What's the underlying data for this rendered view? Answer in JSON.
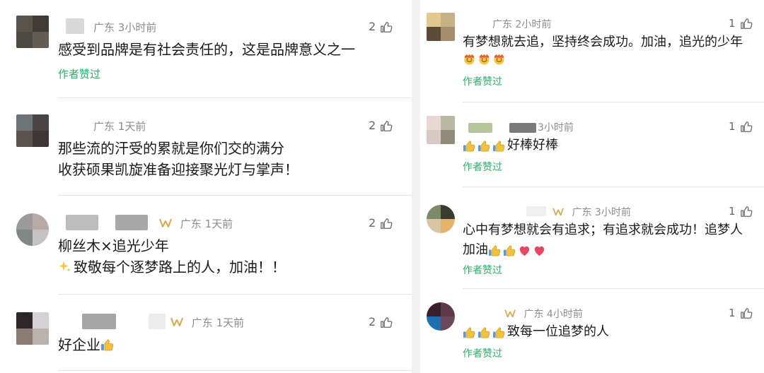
{
  "left": {
    "comments": [
      {
        "location": "广东",
        "time": "3小时前",
        "likes": "2",
        "lines": [
          "感受到品牌是有社会责任的，这是品牌意义之一"
        ],
        "liked_label": "作者赞过"
      },
      {
        "location": "广东",
        "time": "1天前",
        "likes": "2",
        "lines": [
          "那些流的汗受的累就是你们交的满分",
          "收获硕果凯旋准备迎接聚光灯与掌声！"
        ]
      },
      {
        "location": "广东",
        "time": "1天前",
        "likes": "2",
        "lines": [
          "柳丝木×追光少年",
          "致敬每个逐梦路上的人，加油！！"
        ]
      },
      {
        "location": "广东",
        "time": "1天前",
        "likes": "2",
        "lines": [
          "好企业"
        ]
      }
    ]
  },
  "right": {
    "comments": [
      {
        "location": "广东",
        "time": "2小时前",
        "likes": "1",
        "lines": [
          "有梦想就去追，坚持终会成功。加油，追光的少年"
        ],
        "liked_label": "作者赞过"
      },
      {
        "time": "3小时前",
        "likes": "1",
        "lines": [
          "好棒好棒"
        ],
        "liked_label": "作者赞过"
      },
      {
        "location": "广东",
        "time": "3小时前",
        "likes": "1",
        "lines": [
          "心中有梦想就会有追求；有追求就会成功！追梦人",
          "加油"
        ],
        "liked_label": "作者赞过"
      },
      {
        "location": "广东",
        "time": "4小时前",
        "likes": "1",
        "lines": [
          "致每一位追梦的人"
        ],
        "liked_label": "作者赞过"
      }
    ]
  },
  "icons": {
    "thumb": "thumbs-up-outline-icon",
    "medal": "fan-medal-icon",
    "sparkle": "sparkles-emoji-icon",
    "thumbs_emoji": "thumbs-up-emoji-icon",
    "heart_emoji": "red-heart-emoji-icon",
    "cheer_emoji": "cheering-face-emoji-icon"
  },
  "colors": {
    "liked_green": "#2aae67",
    "meta_gray": "#8c8c8c",
    "medal_gold": "#d7a94c",
    "heart_red": "#e8475f",
    "thumb_yellow": "#f3c13a"
  }
}
